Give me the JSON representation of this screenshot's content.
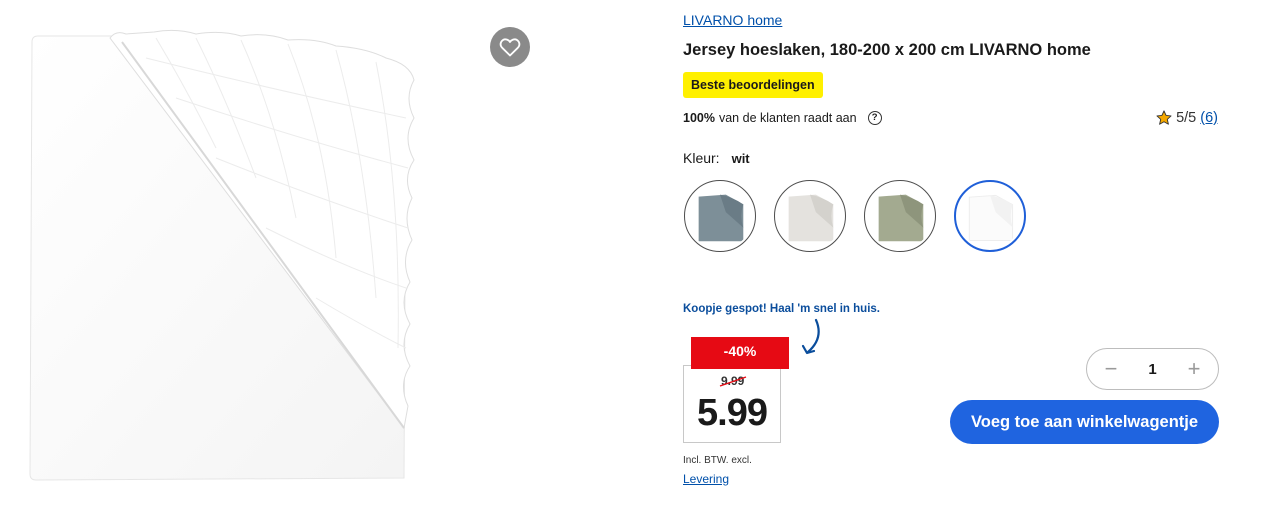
{
  "product": {
    "brand_link": "LIVARNO home",
    "title": "Jersey hoeslaken, 180-200 x 200 cm LIVARNO home",
    "badge": "Beste beoordelingen",
    "recommend_pct": "100%",
    "recommend_text": "van de klanten raadt aan",
    "help_icon": "?",
    "rating": "5/5",
    "rating_count": "(6)"
  },
  "color": {
    "label": "Kleur:",
    "value": "wit",
    "swatches": [
      {
        "name": "blauwgrijs",
        "fill": "#7d8f98"
      },
      {
        "name": "lichtgrijs",
        "fill": "#e4e2de"
      },
      {
        "name": "groen",
        "fill": "#a3aa90"
      },
      {
        "name": "wit",
        "fill": "#ffffff",
        "selected": true
      }
    ]
  },
  "pricing": {
    "promo_text": "Koopje gespot! Haal 'm snel in huis.",
    "discount": "-40%",
    "old_price": "9.99",
    "price": "5.99",
    "tax_note": "Incl. BTW. excl.",
    "delivery_link": "Levering"
  },
  "cart": {
    "quantity": "1",
    "minus": "−",
    "plus": "+",
    "add_button": "Voeg toe aan winkelwagentje"
  },
  "icons": {
    "wishlist": "heart-icon",
    "rating": "star-icon",
    "promo": "curved-arrow-icon"
  },
  "colors": {
    "link": "#0050aa",
    "badge": "#fff000",
    "discount": "#e60a14",
    "cta": "#1f64e0",
    "promo_text": "#0a4d9c"
  }
}
